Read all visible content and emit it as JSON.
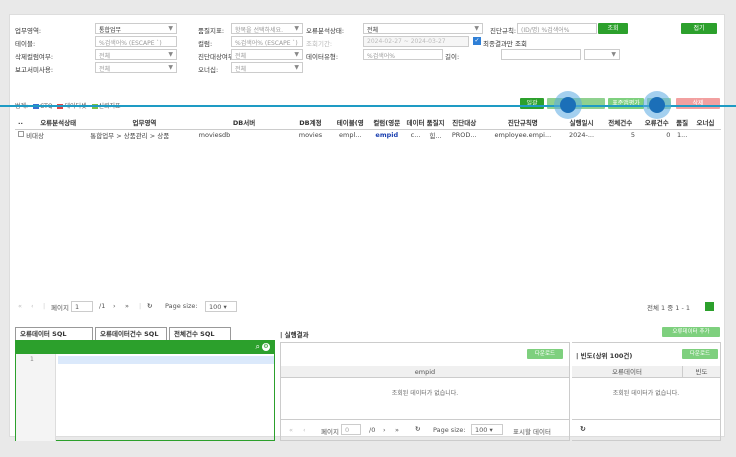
{
  "filters": {
    "row1": {
      "business_area_label": "업무영역:",
      "business_area_value": "통합업무",
      "quality_index_label": "품질지표:",
      "quality_index_placeholder": "항목을 선택하세요.",
      "error_status_label": "오류분석상태:",
      "error_status_value": "전체",
      "diag_rule_label": "진단규칙:",
      "diag_rule_placeholder": "(ID/명) %검색어%",
      "search_button": "조회",
      "collapse_button": "접기"
    },
    "row2": {
      "table_label": "테이블:",
      "table_placeholder": "%검색어% (ESCAPE `)",
      "column_label": "컬럼:",
      "column_placeholder": "%검색어% (ESCAPE `)",
      "period_label": "조회기간:",
      "period_value": "2024-02-27 ~ 2024-03-27",
      "latest_only_label": "최종결과만 조회"
    },
    "row3": {
      "delete_col_label": "삭제컬럼여부:",
      "delete_col_value": "전체",
      "diag_target_label": "진단대상여부:",
      "diag_target_value": "전체",
      "data_type_label": "데이터유형:",
      "data_type_placeholder": "%검색어%",
      "length_label": "길이:"
    },
    "row4": {
      "report_usage_label": "보고서미사용:",
      "report_usage_value": "전체",
      "owner_label": "오너십:",
      "owner_value": "전체"
    }
  },
  "legend": {
    "prefix": "범례:",
    "items": [
      "CTQ",
      "데이터셋",
      "신뢰지표"
    ]
  },
  "toolbar": {
    "btn1": "일괄",
    "btn2": "",
    "btn3": "표준앱평가",
    "btn4": "AI",
    "btn5": "삭제"
  },
  "grid": {
    "columns": [
      "오류분석상태",
      "업무영역",
      "DB서버",
      "DB계정",
      "테이블(영",
      "컬럼(영문",
      "데이터",
      "품질지",
      "진단대상",
      "진단규칙명",
      "실행일시",
      "전체건수",
      "오류건수",
      "품질",
      "오너십"
    ],
    "rows": [
      [
        "비대상",
        "통합업무 > 상품관리 > 상품",
        "moviesdb",
        "movies",
        "empl...",
        "empid",
        "c...",
        "힘...",
        "PROD...",
        "employee.empi...",
        "2024-...",
        "5",
        "0",
        "1...",
        ""
      ]
    ]
  },
  "pager": {
    "page_label": "페이지",
    "page_value": "1",
    "total_pages": "/1",
    "page_size_label": "Page size:",
    "page_size_value": "100",
    "summary": "전체 1 중 1 - 1"
  },
  "sql_tabs": [
    "오류데이터 SQL",
    "오류데이터건수 SQL",
    "전체건수 SQL"
  ],
  "sql_editor": {
    "line1": "1"
  },
  "result": {
    "title": "| 실행결과",
    "add_button": "오류데이터 추가",
    "download_button": "다운로드",
    "column": "empid",
    "empty": "조회된 데이터가 없습니다.",
    "pager_page_label": "페이지",
    "pager_page_value": "0",
    "pager_total": "/0",
    "pager_size_label": "Page size:",
    "pager_size_value": "100",
    "pager_display": "표시할 데이터"
  },
  "freq": {
    "title": "| 빈도(상위 100건)",
    "download_button": "다운로드",
    "col1": "오류데이터",
    "col2": "빈도",
    "empty": "조회된 데이터가 없습니다."
  },
  "colors": {
    "accent_green": "#2ca02c",
    "highlight_blue": "#1e9bc4",
    "danger": "#e05050"
  }
}
